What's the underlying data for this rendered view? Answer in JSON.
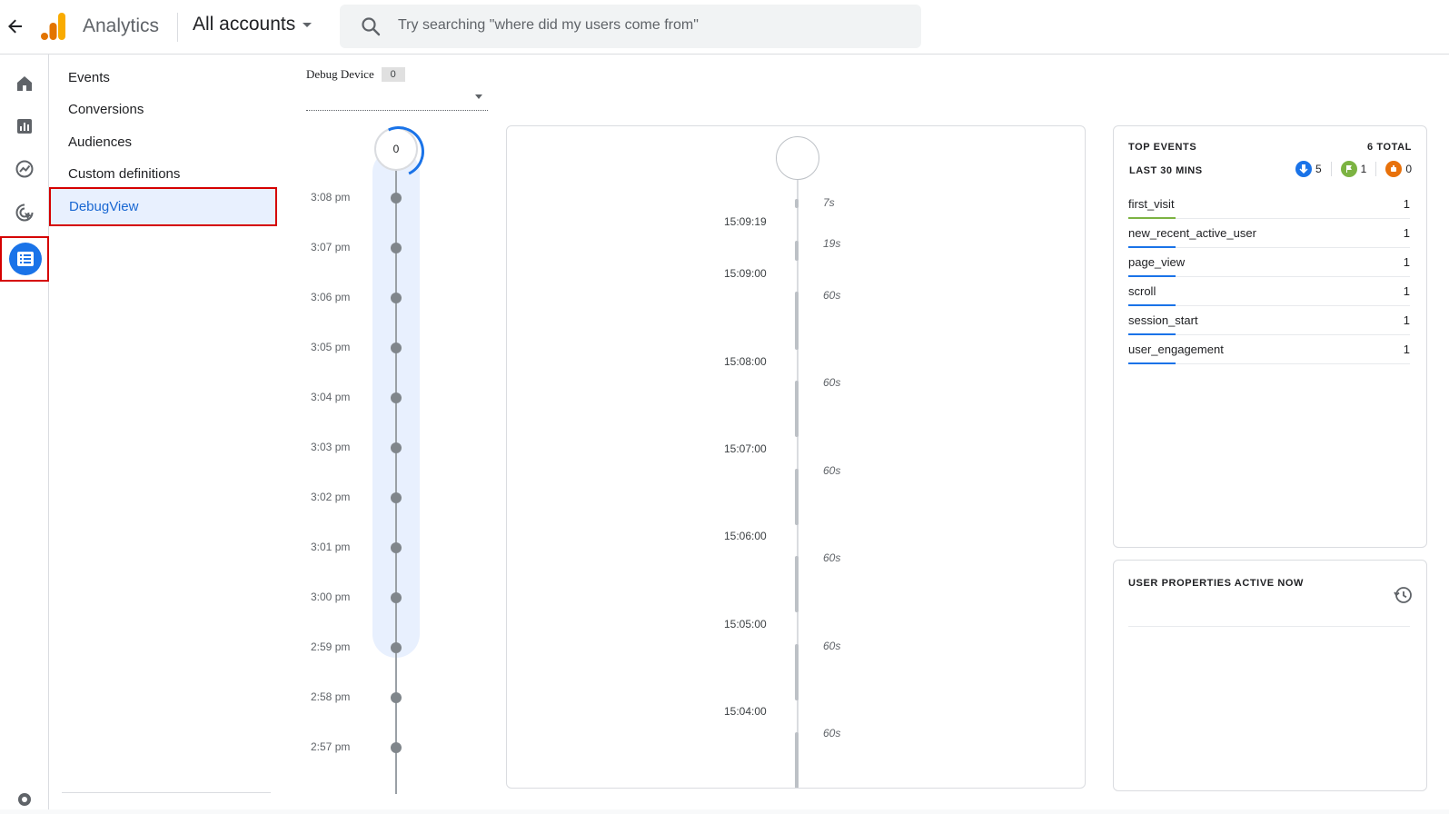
{
  "header": {
    "brand": "Analytics",
    "account": "All accounts",
    "search_placeholder": "Try searching \"where did my users come from\""
  },
  "subnav": {
    "items": [
      {
        "label": "Events"
      },
      {
        "label": "Conversions"
      },
      {
        "label": "Audiences"
      },
      {
        "label": "Custom definitions"
      },
      {
        "label": "DebugView"
      }
    ]
  },
  "debug_device": {
    "label": "Debug Device",
    "count": "0"
  },
  "minutes_stream": {
    "count": "0",
    "times": [
      "3:08 pm",
      "3:07 pm",
      "3:06 pm",
      "3:05 pm",
      "3:04 pm",
      "3:03 pm",
      "3:02 pm",
      "3:01 pm",
      "3:00 pm",
      "2:59 pm",
      "2:58 pm",
      "2:57 pm"
    ]
  },
  "seconds_stream": {
    "timestamps": [
      "15:09:19",
      "15:09:00",
      "15:08:00",
      "15:07:00",
      "15:06:00",
      "15:05:00",
      "15:04:00"
    ],
    "durations": [
      "7s",
      "19s",
      "60s",
      "60s",
      "60s",
      "60s",
      "60s",
      "60s"
    ]
  },
  "top_events": {
    "title": "TOP EVENTS",
    "total": "6 TOTAL",
    "subtitle": "LAST 30 MINS",
    "counters": [
      {
        "icon": "event-icon",
        "value": "5",
        "color": "#1a73e8"
      },
      {
        "icon": "conversion-flag-icon",
        "value": "1",
        "color": "#7cb342"
      },
      {
        "icon": "error-icon",
        "value": "0",
        "color": "#e8710a"
      }
    ],
    "events": [
      {
        "name": "first_visit",
        "count": "1",
        "color": "#7cb342"
      },
      {
        "name": "new_recent_active_user",
        "count": "1",
        "color": "#1a73e8"
      },
      {
        "name": "page_view",
        "count": "1",
        "color": "#1a73e8"
      },
      {
        "name": "scroll",
        "count": "1",
        "color": "#1a73e8"
      },
      {
        "name": "session_start",
        "count": "1",
        "color": "#1a73e8"
      },
      {
        "name": "user_engagement",
        "count": "1",
        "color": "#1a73e8"
      }
    ]
  },
  "user_properties": {
    "title": "USER PROPERTIES ACTIVE NOW"
  }
}
